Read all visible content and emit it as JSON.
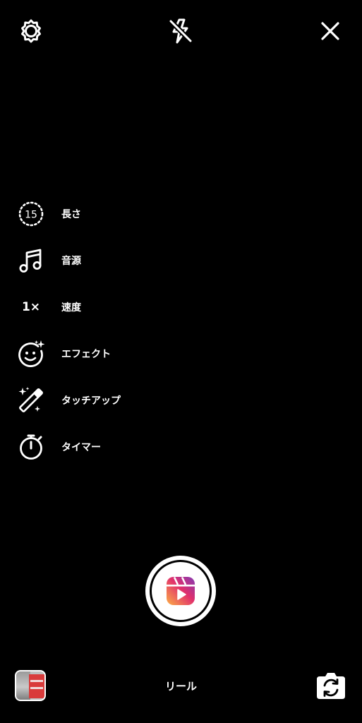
{
  "top_bar": {
    "settings_icon": "gear-icon",
    "flash_icon": "flash-off-icon",
    "close_icon": "close-icon"
  },
  "menu": {
    "items": [
      {
        "label": "長さ",
        "icon": "duration-icon",
        "icon_text": "15"
      },
      {
        "label": "音源",
        "icon": "music-note-icon"
      },
      {
        "label": "速度",
        "icon": "speed-icon",
        "icon_text": "1×"
      },
      {
        "label": "エフェクト",
        "icon": "effects-face-icon"
      },
      {
        "label": "タッチアップ",
        "icon": "magic-wand-icon"
      },
      {
        "label": "タイマー",
        "icon": "stopwatch-icon"
      }
    ]
  },
  "bottom_bar": {
    "mode_label": "リール",
    "gallery_icon": "gallery-thumbnail",
    "flip_icon": "flip-camera-icon"
  },
  "colors": {
    "background": "#000000",
    "foreground": "#ffffff",
    "reels_gradient_start": "#fcaf45",
    "reels_gradient_mid": "#e1306c",
    "reels_gradient_end": "#833ab4"
  }
}
